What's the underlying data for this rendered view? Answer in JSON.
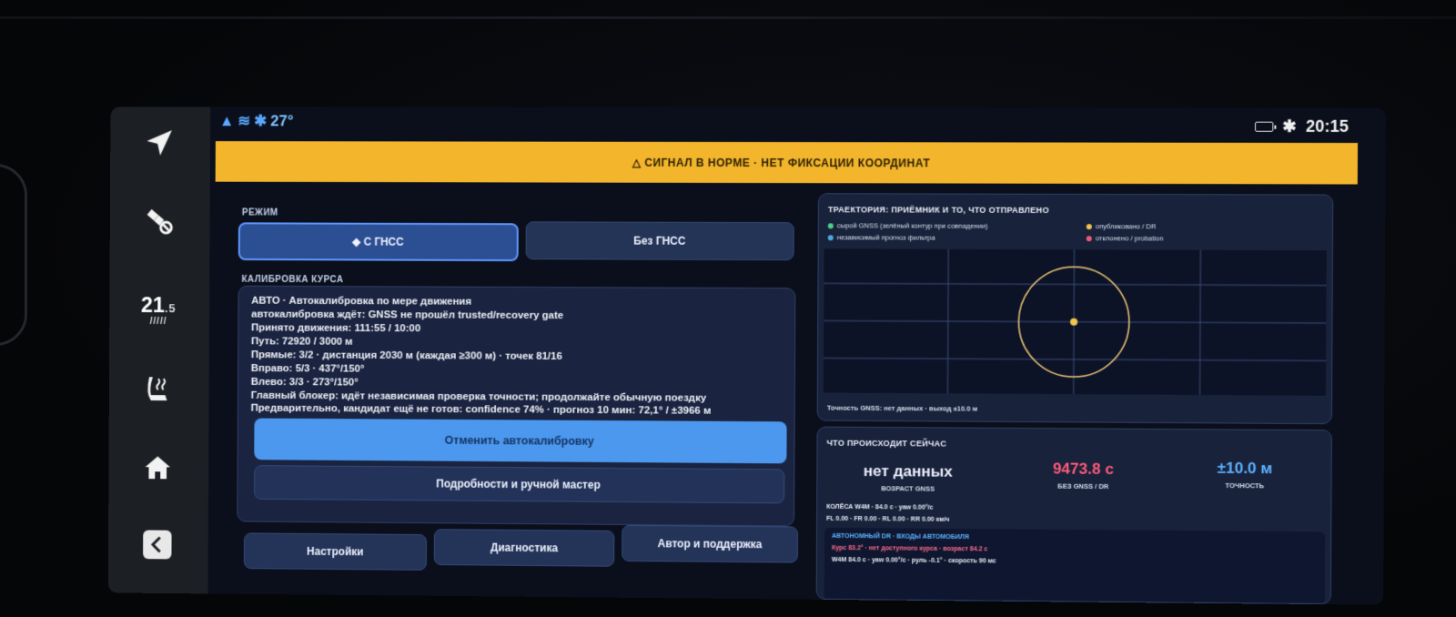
{
  "status": {
    "temperature": "27°",
    "clock": "20:15"
  },
  "dock": {
    "temp_big": "21",
    "temp_small_suffix": ".5",
    "fan_bars": "/////"
  },
  "banner": {
    "text": "△ СИГНАЛ В НОРМЕ · НЕТ ФИКСАЦИИ КООРДИНАТ"
  },
  "mode": {
    "label": "РЕЖИМ",
    "gnss_label": "◆ С ГНСС",
    "nognss_label": "Без ГНСС"
  },
  "calibration": {
    "label": "КАЛИБРОВКА КУРСА",
    "lines": [
      "АВТО · Автокалибровка по мере движения",
      "автокалибровка ждёт: GNSS не прошёл trusted/recovery gate",
      "Принято движения: 111:55 / 10:00",
      "Путь: 72920 / 3000 м",
      "Прямые: 3/2 · дистанция 2030 м (каждая ≥300 м) · точек 81/16",
      "Вправо: 5/3 · 437°/150°",
      "Влево: 3/3 · 273°/150°",
      "Главный блокер: идёт независимая проверка точности; продолжайте обычную поездку",
      "Предварительно, кандидат ещё не готов: confidence 74% · прогноз 10 мин: 72,1° / ±3966 м"
    ],
    "cancel_button": "Отменить автокалибровку",
    "details_button": "Подробности и ручной мастер"
  },
  "bottom_nav": {
    "settings": "Настройки",
    "diagnostics": "Диагностика",
    "author": "Автор и поддержка"
  },
  "trajectory": {
    "title": "ТРАЕКТОРИЯ: ПРИЁМНИК И ТО, ЧТО ОТПРАВЛЕНО",
    "legend": {
      "raw_gnss": "сырой GNSS (зелёный контур при совпадении)",
      "forecast": "независимый прогноз фильтра",
      "published": "опубликовано / DR",
      "rejected": "отклонено / probation"
    },
    "footer": "Точность GNSS: нет данных · выход ±10.0 м",
    "colors": {
      "raw_gnss": "#4fd08a",
      "forecast": "#4fa8e0",
      "published": "#f3c44f",
      "rejected": "#e85b78",
      "circle": "#f0c877"
    }
  },
  "now": {
    "title": "ЧТО ПРОИСХОДИТ СЕЙЧАС",
    "gnss_age_value": "нет данных",
    "gnss_age_label": "ВОЗРАСТ GNSS",
    "dr_value": "9473.8 с",
    "dr_label": "БЕЗ GNSS / DR",
    "accuracy_value": "±10.0 м",
    "accuracy_label": "ТОЧНОСТЬ",
    "wheels_line1": "КОЛЁСА W4M · 84.0 с · yaw 0.00°/с",
    "wheels_line2": "FL 0.00 · FR 0.00 · RL 0.00 · RR 0.00 км/ч",
    "dr_title": "АВТОНОМНЫЙ DR · ВХОДЫ АВТОМОБИЛЯ",
    "dr_line1": "Курс 83.2° · нет доступного курса · возраст 84.2 с",
    "dr_line2": "W4M 84.0 с · yaw 0.00°/с · руль -0.1° · скорость 90 мс",
    "colors": {
      "dr_value": "#ff5a7a",
      "accuracy_value": "#5db2ff",
      "dr_title": "#5db2ff",
      "dr_line1": "#ff6b8a"
    }
  }
}
